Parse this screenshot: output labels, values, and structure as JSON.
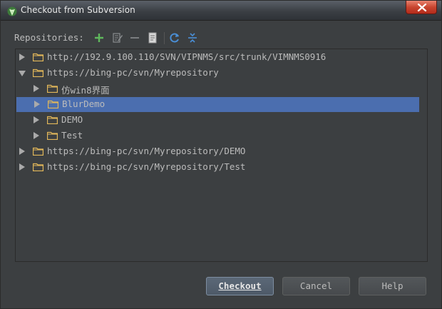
{
  "window": {
    "title": "Checkout from Subversion",
    "app_icon": "android-studio-icon",
    "close_icon": "close-icon"
  },
  "toolbar": {
    "label": "Repositories:",
    "icons": [
      "add-icon",
      "edit-icon",
      "remove-icon",
      "browse-icon",
      "refresh-icon",
      "collapse-all-icon"
    ]
  },
  "tree": {
    "rows": [
      {
        "level": 0,
        "expanded": false,
        "label": "http://192.9.100.110/SVN/VIPNMS/src/trunk/VIMNMS0916",
        "selected": false
      },
      {
        "level": 0,
        "expanded": true,
        "label": "https://bing-pc/svn/Myrepository",
        "selected": false
      },
      {
        "level": 1,
        "expanded": false,
        "label": "仿win8界面",
        "selected": false
      },
      {
        "level": 1,
        "expanded": false,
        "label": "BlurDemo",
        "selected": true
      },
      {
        "level": 1,
        "expanded": false,
        "label": "DEMO",
        "selected": false
      },
      {
        "level": 1,
        "expanded": false,
        "label": "Test",
        "selected": false
      },
      {
        "level": 0,
        "expanded": false,
        "label": "https://bing-pc/svn/Myrepository/DEMO",
        "selected": false
      },
      {
        "level": 0,
        "expanded": false,
        "label": "https://bing-pc/svn/Myrepository/Test",
        "selected": false
      }
    ]
  },
  "buttons": {
    "checkout": "Checkout",
    "cancel": "Cancel",
    "help": "Help"
  },
  "colors": {
    "background": "#3c3f41",
    "selection": "#4b6eaf",
    "text": "#bbbbbb",
    "folder": "#e3b85a",
    "add": "#5fb85c",
    "refresh": "#4a8fd6"
  }
}
